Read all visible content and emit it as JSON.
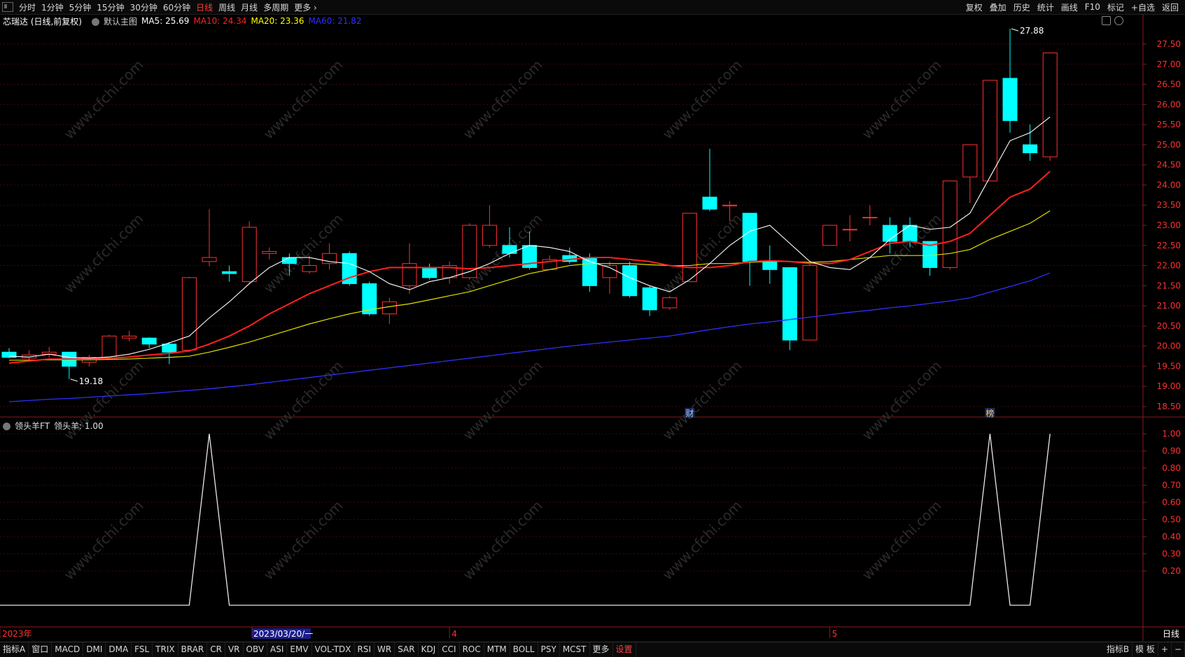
{
  "toolbar": {
    "periods": [
      "分时",
      "1分钟",
      "5分钟",
      "15分钟",
      "30分钟",
      "60分钟",
      "日线",
      "周线",
      "月线",
      "多周期",
      "更多 ›"
    ],
    "active_index": 6,
    "right_items": [
      "复权",
      "叠加",
      "历史",
      "统计",
      "画线",
      "F10",
      "标记",
      "+自选",
      "返回"
    ]
  },
  "info": {
    "stock_name": "芯瑞达 (日线,前复权)",
    "main_label": "默认主图",
    "ma": [
      {
        "label": "MA5: 25.69",
        "color": "#ffffff"
      },
      {
        "label": "MA10: 24.34",
        "color": "#ff2020"
      },
      {
        "label": "MA20: 23.36",
        "color": "#ffff00"
      },
      {
        "label": "MA60: 21.82",
        "color": "#3030ff"
      }
    ]
  },
  "sub_info": {
    "indicator": "领头羊FT",
    "value": "领头羊: 1.00"
  },
  "bottom": {
    "left_tab": "指标A",
    "tabs": [
      "窗口",
      "MACD",
      "DMI",
      "DMA",
      "FSL",
      "TRIX",
      "BRAR",
      "CR",
      "VR",
      "OBV",
      "ASI",
      "EMV",
      "VOL-TDX",
      "RSI",
      "WR",
      "SAR",
      "KDJ",
      "CCI",
      "ROC",
      "MTM",
      "BOLL",
      "PSY",
      "MCST",
      "更多",
      "设置"
    ],
    "right_tabs": [
      "指标B",
      "模 板",
      "+",
      "−"
    ]
  },
  "chart_data": [
    {
      "type": "candlestick",
      "y_ticks": [
        "27.50",
        "27.00",
        "26.50",
        "26.00",
        "25.50",
        "25.00",
        "24.50",
        "24.00",
        "23.50",
        "23.00",
        "22.50",
        "22.00",
        "21.50",
        "21.00",
        "20.50",
        "20.00",
        "19.50",
        "19.00",
        "18.50"
      ],
      "ylim": [
        18.4,
        28.3
      ],
      "candles": [
        [
          19.85,
          19.72,
          19.95,
          19.7
        ],
        [
          19.7,
          19.78,
          19.9,
          19.62
        ],
        [
          19.8,
          19.85,
          19.98,
          19.72
        ],
        [
          19.85,
          19.5,
          19.85,
          19.18
        ],
        [
          19.6,
          19.72,
          19.78,
          19.5
        ],
        [
          19.7,
          20.25,
          20.28,
          19.68
        ],
        [
          20.2,
          20.25,
          20.38,
          20.12
        ],
        [
          20.2,
          20.05,
          20.22,
          19.95
        ],
        [
          20.05,
          19.85,
          20.1,
          19.55
        ],
        [
          19.9,
          21.7,
          21.72,
          19.85
        ],
        [
          22.1,
          22.2,
          23.4,
          21.98
        ],
        [
          21.85,
          21.8,
          22.0,
          21.6
        ],
        [
          21.6,
          22.95,
          23.1,
          21.55
        ],
        [
          22.3,
          22.35,
          22.45,
          22.15
        ],
        [
          22.2,
          22.05,
          22.3,
          21.75
        ],
        [
          21.85,
          22.0,
          22.25,
          21.8
        ],
        [
          22.05,
          22.3,
          22.55,
          21.9
        ],
        [
          22.3,
          21.55,
          22.35,
          21.5
        ],
        [
          21.55,
          20.8,
          21.6,
          20.75
        ],
        [
          20.8,
          21.1,
          21.2,
          20.55
        ],
        [
          21.5,
          22.05,
          22.55,
          21.3
        ],
        [
          21.95,
          21.7,
          22.05,
          21.65
        ],
        [
          21.7,
          22.0,
          22.1,
          21.55
        ],
        [
          21.7,
          23.0,
          23.05,
          21.65
        ],
        [
          22.5,
          23.0,
          23.5,
          22.45
        ],
        [
          22.5,
          22.3,
          22.95,
          22.2
        ],
        [
          22.5,
          21.95,
          22.85,
          21.9
        ],
        [
          21.9,
          22.15,
          22.25,
          21.9
        ],
        [
          22.25,
          22.1,
          22.45,
          22.05
        ],
        [
          22.2,
          21.5,
          22.3,
          21.35
        ],
        [
          21.7,
          22.0,
          22.1,
          21.3
        ],
        [
          22.0,
          21.25,
          22.1,
          21.2
        ],
        [
          21.45,
          20.9,
          21.5,
          20.75
        ],
        [
          20.95,
          21.2,
          21.25,
          20.9
        ],
        [
          21.6,
          23.3,
          23.3,
          21.6
        ],
        [
          23.7,
          23.4,
          24.9,
          23.35
        ],
        [
          23.5,
          23.5,
          23.6,
          23.1
        ],
        [
          23.3,
          22.1,
          23.3,
          21.5
        ],
        [
          22.1,
          21.9,
          22.5,
          21.55
        ],
        [
          21.95,
          20.15,
          21.95,
          19.9
        ],
        [
          20.15,
          22.0,
          22.05,
          20.15
        ],
        [
          22.5,
          23.0,
          23.0,
          22.5
        ],
        [
          22.9,
          22.9,
          23.25,
          22.6
        ],
        [
          23.2,
          23.2,
          23.5,
          23.0
        ],
        [
          23.0,
          22.6,
          23.2,
          22.3
        ],
        [
          23.0,
          22.6,
          23.2,
          22.45
        ],
        [
          22.6,
          21.95,
          22.6,
          21.75
        ],
        [
          21.95,
          24.1,
          24.1,
          21.9
        ],
        [
          24.2,
          25.0,
          25.0,
          23.55
        ],
        [
          24.1,
          26.6,
          26.6,
          24.1
        ],
        [
          26.65,
          25.6,
          27.88,
          25.3
        ],
        [
          25.0,
          24.8,
          25.5,
          24.6
        ],
        [
          24.7,
          27.28,
          27.28,
          24.6
        ]
      ],
      "ma5": [
        19.75,
        19.73,
        19.8,
        19.72,
        19.7,
        19.73,
        19.8,
        19.92,
        20.08,
        20.25,
        20.7,
        21.1,
        21.55,
        21.95,
        22.2,
        22.2,
        22.1,
        22.05,
        21.85,
        21.55,
        21.4,
        21.6,
        21.7,
        21.85,
        22.05,
        22.3,
        22.5,
        22.45,
        22.35,
        22.1,
        21.95,
        21.7,
        21.5,
        21.35,
        21.65,
        22.05,
        22.5,
        22.85,
        23.0,
        22.55,
        22.1,
        21.95,
        21.9,
        22.2,
        22.65,
        23.0,
        22.9,
        22.95,
        23.3,
        24.2,
        25.1,
        25.3,
        25.69
      ],
      "ma10": [
        19.58,
        19.63,
        19.68,
        19.68,
        19.68,
        19.7,
        19.73,
        19.78,
        19.82,
        19.88,
        20.05,
        20.25,
        20.5,
        20.8,
        21.05,
        21.3,
        21.5,
        21.7,
        21.85,
        21.95,
        21.95,
        21.95,
        21.95,
        21.92,
        21.95,
        22.0,
        22.05,
        22.1,
        22.15,
        22.2,
        22.2,
        22.15,
        22.1,
        22.0,
        21.95,
        21.95,
        22.0,
        22.1,
        22.12,
        22.1,
        22.05,
        22.05,
        22.15,
        22.35,
        22.55,
        22.6,
        22.5,
        22.6,
        22.8,
        23.25,
        23.7,
        23.9,
        24.34
      ],
      "ma20": [
        19.65,
        19.65,
        19.66,
        19.66,
        19.66,
        19.67,
        19.68,
        19.7,
        19.72,
        19.75,
        19.85,
        19.97,
        20.1,
        20.25,
        20.4,
        20.55,
        20.68,
        20.8,
        20.9,
        20.98,
        21.05,
        21.15,
        21.25,
        21.35,
        21.5,
        21.65,
        21.8,
        21.9,
        22.0,
        22.05,
        22.05,
        22.05,
        22.02,
        22.0,
        22.0,
        22.05,
        22.05,
        22.08,
        22.1,
        22.1,
        22.08,
        22.1,
        22.15,
        22.2,
        22.25,
        22.25,
        22.25,
        22.3,
        22.4,
        22.65,
        22.85,
        23.05,
        23.36
      ],
      "ma60": [
        18.62,
        18.65,
        18.68,
        18.7,
        18.73,
        18.76,
        18.79,
        18.82,
        18.86,
        18.9,
        18.94,
        18.99,
        19.04,
        19.1,
        19.16,
        19.22,
        19.28,
        19.34,
        19.4,
        19.46,
        19.52,
        19.58,
        19.64,
        19.7,
        19.76,
        19.82,
        19.88,
        19.94,
        20.0,
        20.05,
        20.1,
        20.15,
        20.2,
        20.25,
        20.33,
        20.41,
        20.48,
        20.55,
        20.6,
        20.66,
        20.72,
        20.78,
        20.84,
        20.89,
        20.95,
        21.0,
        21.06,
        21.12,
        21.2,
        21.34,
        21.48,
        21.62,
        21.82
      ],
      "annotations": [
        {
          "candle_index": 50,
          "price": 27.88,
          "text": "27.88"
        },
        {
          "candle_index": 3,
          "price": 19.18,
          "text": "19.18"
        }
      ],
      "event_markers": [
        {
          "candle_index": 34,
          "text": "财"
        },
        {
          "candle_index": 49,
          "text": "榜"
        }
      ]
    },
    {
      "type": "line",
      "name": "领头羊",
      "y_ticks": [
        "1.00",
        "0.90",
        "0.80",
        "0.70",
        "0.60",
        "0.50",
        "0.40",
        "0.30",
        "0.20"
      ],
      "ylim": [
        0,
        1.05
      ],
      "points": [
        [
          0,
          0
        ],
        [
          9,
          0
        ],
        [
          10,
          1
        ],
        [
          11,
          0
        ],
        [
          48,
          0
        ],
        [
          49,
          1
        ],
        [
          50,
          0
        ],
        [
          51,
          0
        ],
        [
          52,
          1
        ]
      ]
    }
  ],
  "x_labels": [
    {
      "candle_index": 0,
      "text": "2023年",
      "color": "#ff3030"
    },
    {
      "candle_index": 12,
      "text": "2023/03/20/一",
      "color": "#ffffff",
      "highlight": true
    },
    {
      "candle_index": 22,
      "text": "4",
      "color": "#ff3030"
    },
    {
      "candle_index": 41,
      "text": "5",
      "color": "#ff3030"
    }
  ],
  "period_label": "日线",
  "watermark": "www.cfchi.com"
}
